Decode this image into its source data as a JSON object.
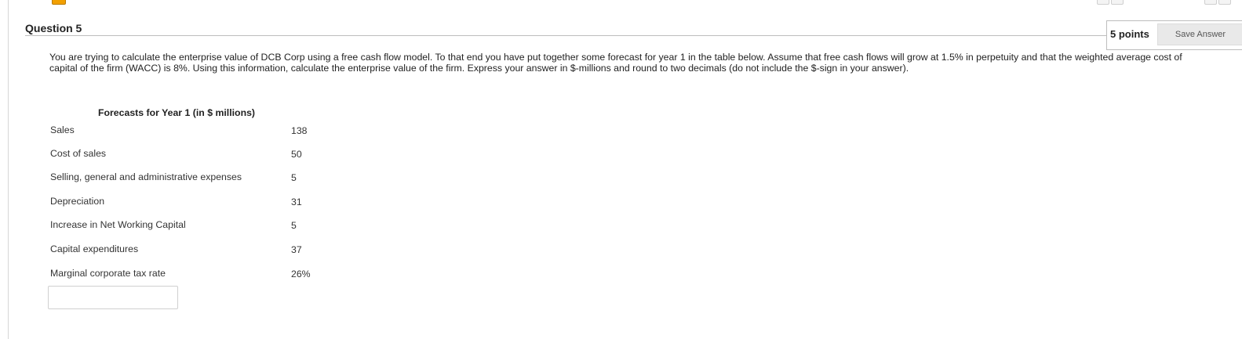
{
  "question": {
    "title": "Question 5",
    "points": "5 points",
    "save_label": "Save Answer",
    "text": "You are trying to calculate the enterprise value of DCB Corp using a free cash flow model. To that end you have put together some forecast for year 1 in the table below. Assume that free cash flows will grow at 1.5% in perpetuity and that the weighted average cost of capital of the firm (WACC) is 8%. Using this information, calculate the enterprise value of the firm. Express your answer in $-millions and round to two decimals (do not include the $-sign in your answer)."
  },
  "table": {
    "caption": "Forecasts for Year 1 (in $ millions)",
    "rows": [
      {
        "label": "Sales",
        "value": "138"
      },
      {
        "label": "Cost of sales",
        "value": "50"
      },
      {
        "label": "Selling, general and administrative expenses",
        "value": "5"
      },
      {
        "label": "Depreciation",
        "value": "31"
      },
      {
        "label": "Increase in Net Working Capital",
        "value": "5"
      },
      {
        "label": "Capital expenditures",
        "value": "37"
      },
      {
        "label": "Marginal corporate tax rate",
        "value": "26%"
      }
    ]
  },
  "answer": {
    "value": ""
  },
  "icons": {
    "warning": "warning-icon"
  }
}
